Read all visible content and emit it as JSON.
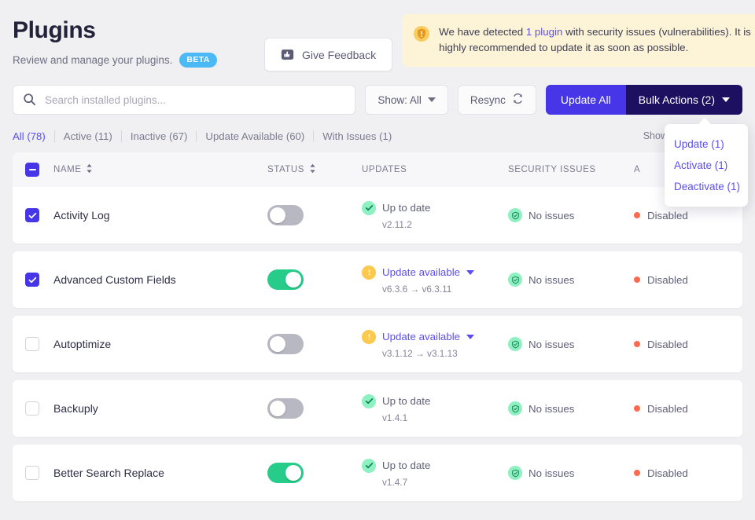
{
  "header": {
    "title": "Plugins",
    "subtitle": "Review and manage your plugins.",
    "beta_badge": "BETA",
    "feedback_button": "Give Feedback"
  },
  "alert": {
    "icon": "shield-warning-icon",
    "text_before": "We have detected ",
    "link": "1 plugin",
    "text_after": " with security issues (vulnerabilities). It is highly recommended to update it as soon as possible.",
    "bg_color": "#fdf4d8",
    "icon_color": "#f0ab1f",
    "link_color": "#5b4ef0"
  },
  "toolbar": {
    "search_placeholder": "Search installed plugins...",
    "search_value": "",
    "show_filter_label": "Show: All",
    "resync_label": "Resync",
    "update_all_label": "Update All",
    "bulk_actions_label": "Bulk Actions (2)",
    "update_all_color": "#4636e8",
    "bulk_actions_color": "#1d1060"
  },
  "bulk_dropdown": {
    "open": true,
    "items": [
      {
        "label": "Update (1)"
      },
      {
        "label": "Activate (1)"
      },
      {
        "label": "Deactivate (1)"
      }
    ],
    "text_color": "#5b4ef0"
  },
  "filter_tabs": {
    "items": [
      {
        "label": "All (78)",
        "active": true
      },
      {
        "label": "Active (11)",
        "active": false
      },
      {
        "label": "Inactive (67)",
        "active": false
      },
      {
        "label": "Update Available (60)",
        "active": false
      },
      {
        "label": "With Issues (1)",
        "active": false
      }
    ],
    "right_label": "Show",
    "active_color": "#5b4ef0"
  },
  "table": {
    "select_all_state": "indeterminate",
    "columns": [
      {
        "label": "NAME",
        "sortable": true
      },
      {
        "label": "STATUS",
        "sortable": true
      },
      {
        "label": "UPDATES",
        "sortable": false
      },
      {
        "label": "SECURITY ISSUES",
        "sortable": false
      },
      {
        "label": "A",
        "sortable": false
      }
    ],
    "rows": [
      {
        "name": "Activity Log",
        "checked": true,
        "enabled": false,
        "update_status": "Up to date",
        "update_has_action": false,
        "version": "v2.11.2",
        "security": "No issues",
        "auto_update": "Disabled"
      },
      {
        "name": "Advanced Custom Fields",
        "checked": true,
        "enabled": true,
        "update_status": "Update available",
        "update_has_action": true,
        "version": "v6.3.6 → v6.3.11",
        "security": "No issues",
        "auto_update": "Disabled"
      },
      {
        "name": "Autoptimize",
        "checked": false,
        "enabled": false,
        "update_status": "Update available",
        "update_has_action": true,
        "version": "v3.1.12 → v3.1.13",
        "security": "No issues",
        "auto_update": "Disabled"
      },
      {
        "name": "Backuply",
        "checked": false,
        "enabled": false,
        "update_status": "Up to date",
        "update_has_action": false,
        "version": "v1.4.1",
        "security": "No issues",
        "auto_update": "Disabled"
      },
      {
        "name": "Better Search Replace",
        "checked": false,
        "enabled": true,
        "update_status": "Up to date",
        "update_has_action": false,
        "version": "v1.4.7",
        "security": "No issues",
        "auto_update": "Disabled"
      }
    ]
  }
}
